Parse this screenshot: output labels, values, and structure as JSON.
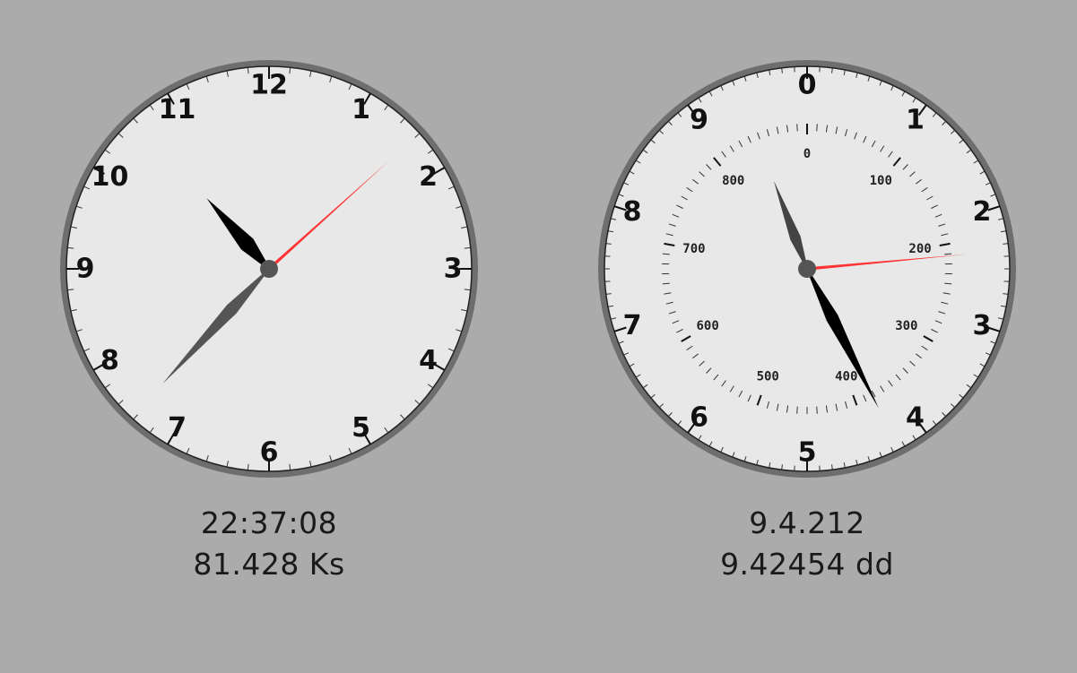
{
  "clocks": [
    {
      "id": "standard",
      "numerals": [
        "12",
        "1",
        "2",
        "3",
        "4",
        "5",
        "6",
        "7",
        "8",
        "9",
        "10",
        "11"
      ],
      "digital_time": "22:37:08",
      "digital_secondary": "81.428 Ks",
      "hand_values": {
        "hour": 10.6189,
        "minute": 37.133,
        "second": 8
      },
      "colors": {
        "face": "#e8e8e8",
        "rim": "#6e6e6e",
        "hands": "#000000",
        "second_hand": "#ff3333",
        "hub": "#555555"
      }
    },
    {
      "id": "decimal",
      "numerals": [
        "0",
        "1",
        "2",
        "3",
        "4",
        "5",
        "6",
        "7",
        "8",
        "9"
      ],
      "inner_numerals": [
        "0",
        "100",
        "200",
        "300",
        "400",
        "500",
        "600",
        "700",
        "800"
      ],
      "digital_time": "9.4.212",
      "digital_secondary": "9.42454 dd",
      "hand_values": {
        "hour": 9.42454,
        "minute": 42.454,
        "second": 212
      },
      "colors": {
        "face": "#e8e8e8",
        "rim": "#6e6e6e",
        "hands": "#000000",
        "second_hand": "#ff3333",
        "hub": "#555555"
      }
    }
  ]
}
